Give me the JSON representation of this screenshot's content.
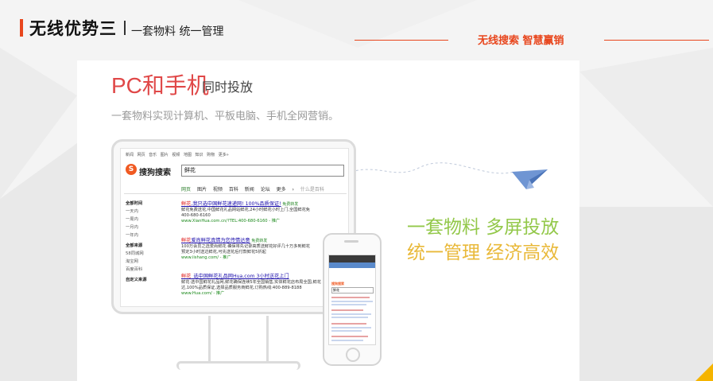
{
  "header": {
    "title": "无线优势三",
    "subtitle": "一套物料 统一管理",
    "tagline": "无线搜索 智慧赢销"
  },
  "card": {
    "title_main": "PC和手机",
    "title_sub": "同时投放",
    "description": "一套物料实现计算机、平板电脑、手机全网营销。",
    "slogan_line1": "一套物料 多屏投放",
    "slogan_line2": "统一管理 经济高效"
  },
  "sogou_screen": {
    "top_nav": "新闻 网页 音乐 图片 视频 地图 知识 购物 更多»",
    "logo_text": "搜狗搜索",
    "search_value": "鲜花",
    "tabs": [
      "网页",
      "图片",
      "视频",
      "百科",
      "新闻",
      "论坛",
      "更多 ›",
      "什么是百科"
    ],
    "sidebar": {
      "heading1": "全部时间",
      "time_items": [
        "一天内",
        "一周内",
        "一月内",
        "一年内"
      ],
      "heading2": "全部来源",
      "source_items": [
        "58同城网",
        "淘宝网",
        "百度百科"
      ],
      "heading3": "自定义来源"
    },
    "results": [
      {
        "title_hl": "鲜花",
        "title_rest": ",我只选中国鲜花速递网! 100%品质保证!",
        "badge": "免费转发",
        "lines": [
          "鲜花免费送花,中国鲜花礼品网站鲜花,24小时鲜花小时上门,全国鲜花免",
          "400-680-6160"
        ],
        "url": "www.XianHua.com.cn/?TEL:400-680-6160 - 推广"
      },
      {
        "title_hl": "鲜花",
        "title_rest": "爱尚鲜花真情为您传情达意",
        "badge": "免费转发",
        "lines": [
          "100万会员之选爱尚鲜花 确保将先记录高质送鲜花好评几十万多到鲜花",
          "预定3小时送达鲜花,可先送花后付款鲜花5折起"
        ],
        "url": "www.iishang.com/ - 推广"
      },
      {
        "title_hl": "鲜花",
        "title_rest": "_选中国鲜花礼品网Hua.com 3小时送花上门",
        "badge": "",
        "lines": [
          "鲜花·选中国鲜花礼品网,鲜花确保连续5年全国销售,实体鲜花店布局全国,鲜花",
          "达,100%品质保证,选择品质服务商鲜花,订购热线:400-889-8188"
        ],
        "url": "www.Hua.com/ - 推广"
      }
    ]
  },
  "phone_screen": {
    "logo": "搜狗搜索",
    "search": "鲜花"
  },
  "colors": {
    "accent": "#e8461d",
    "title_red": "#e04848",
    "slogan_green": "#93c84a",
    "slogan_yellow": "#e9b93a",
    "plane_blue": "#6f95d3",
    "corner_yellow": "#f5b400"
  },
  "icons": {
    "plane": "paper-plane-icon",
    "sogou": "sogou-logo-icon"
  }
}
